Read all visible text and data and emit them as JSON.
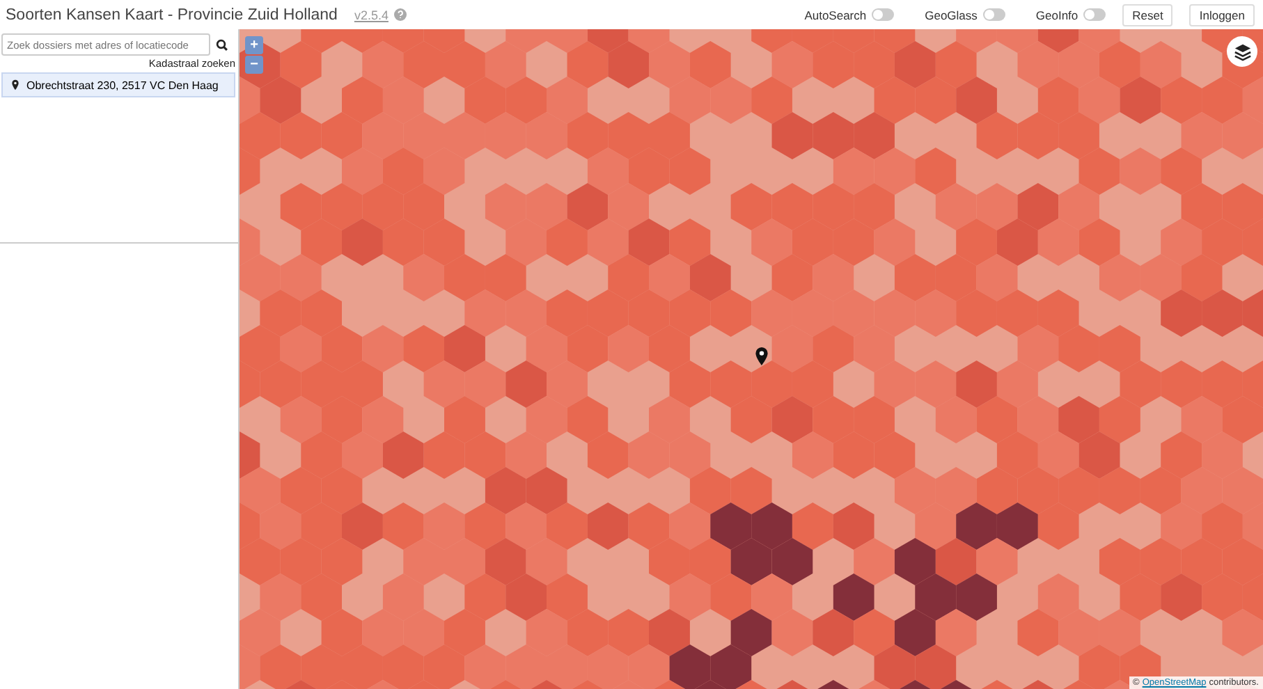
{
  "header": {
    "title": "Soorten Kansen Kaart - Provincie Zuid Holland",
    "version": "v2.5.4",
    "toggles": [
      {
        "label": "AutoSearch",
        "on": false
      },
      {
        "label": "GeoGlass",
        "on": false
      },
      {
        "label": "GeoInfo",
        "on": false
      }
    ],
    "buttons": [
      "Reset",
      "Inloggen"
    ]
  },
  "sidebar": {
    "search": {
      "placeholder": "Zoek dossiers met adres of locatiecode"
    },
    "link": "Kadastraal zoeken",
    "results": [
      {
        "text": "Obrechtstraat 230, 2517 VC Den Haag",
        "selected": true
      }
    ]
  },
  "map": {
    "zoom_buttons": [
      "+",
      "−"
    ],
    "attribution": {
      "prefix": "©",
      "link": "OpenStreetMap",
      "suffix": "contributors."
    }
  }
}
